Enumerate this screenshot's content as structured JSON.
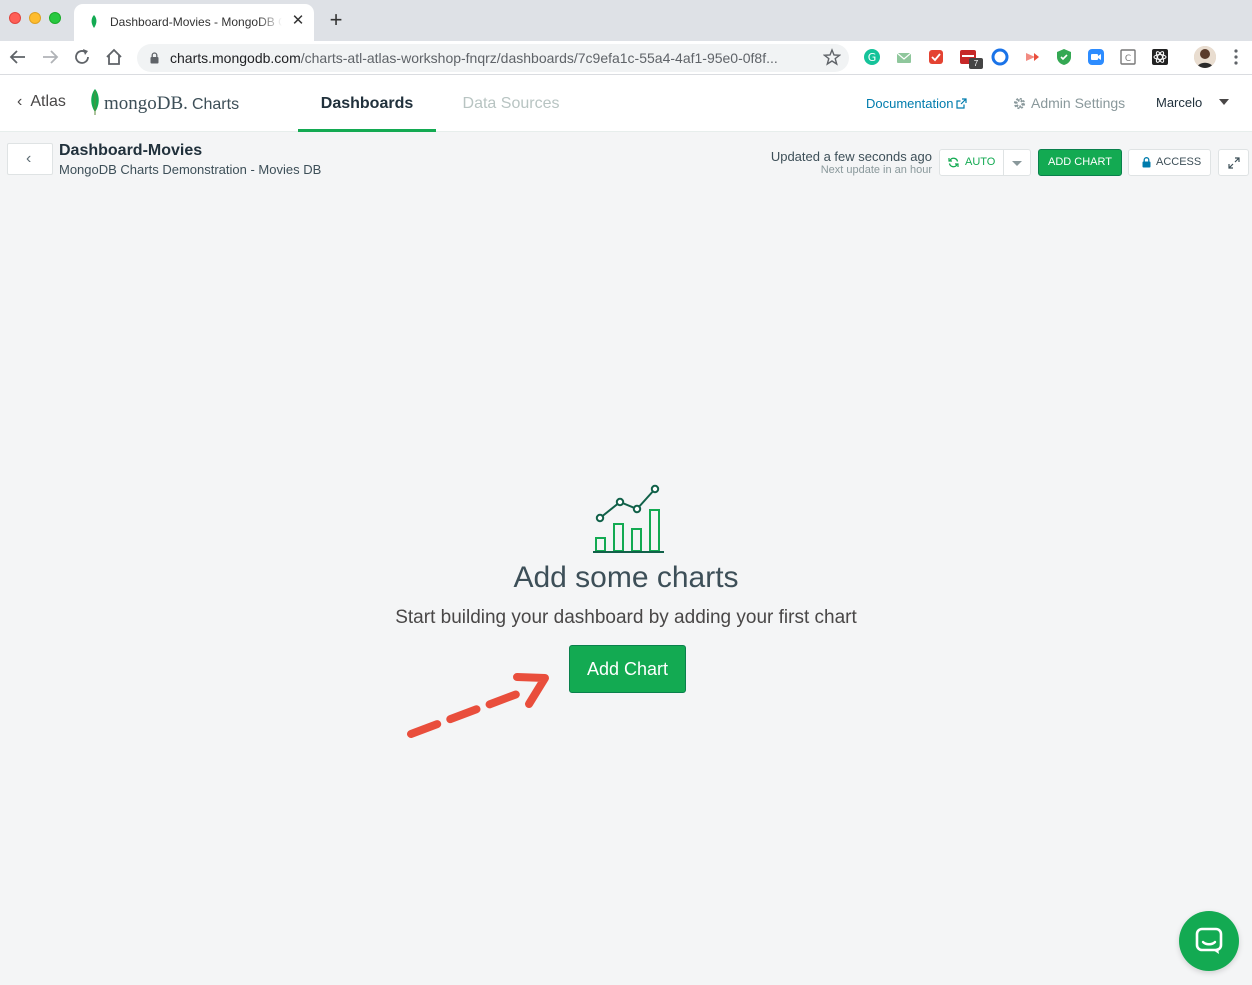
{
  "browser": {
    "tab_title": "Dashboard-Movies - MongoDB Charts",
    "close_glyph": "✕",
    "new_tab_glyph": "+",
    "url_host": "charts.mongodb.com",
    "url_path": "/charts-atl-atlas-workshop-fnqrz/dashboards/7c9efa1c-55a4-4af1-95e0-0f8f...",
    "extension_badge": "7"
  },
  "header": {
    "back_label": "Atlas",
    "logo_mongo": "mongoDB.",
    "logo_charts": "Charts",
    "tabs": [
      {
        "label": "Dashboards",
        "active": true
      },
      {
        "label": "Data Sources",
        "active": false
      }
    ],
    "documentation": "Documentation",
    "admin_settings": "Admin Settings",
    "user": "Marcelo"
  },
  "dashboard": {
    "title": "Dashboard-Movies",
    "subtitle": "MongoDB Charts Demonstration - Movies DB",
    "updated": "Updated a few seconds ago",
    "next_update": "Next update in an hour",
    "auto_label": "AUTO",
    "add_chart_label": "ADD CHART",
    "access_label": "ACCESS"
  },
  "empty_state": {
    "title": "Add some charts",
    "subtitle": "Start building your dashboard by adding your first chart",
    "button": "Add Chart"
  },
  "colors": {
    "accent_green": "#13aa52",
    "link_blue": "#007cad",
    "arrow_red": "#e94e3c"
  },
  "icons": {
    "tab_favicon": "mongodb-leaf-icon",
    "chat": "chat-bubble-icon",
    "empty_state": "line-bar-chart-icon"
  }
}
